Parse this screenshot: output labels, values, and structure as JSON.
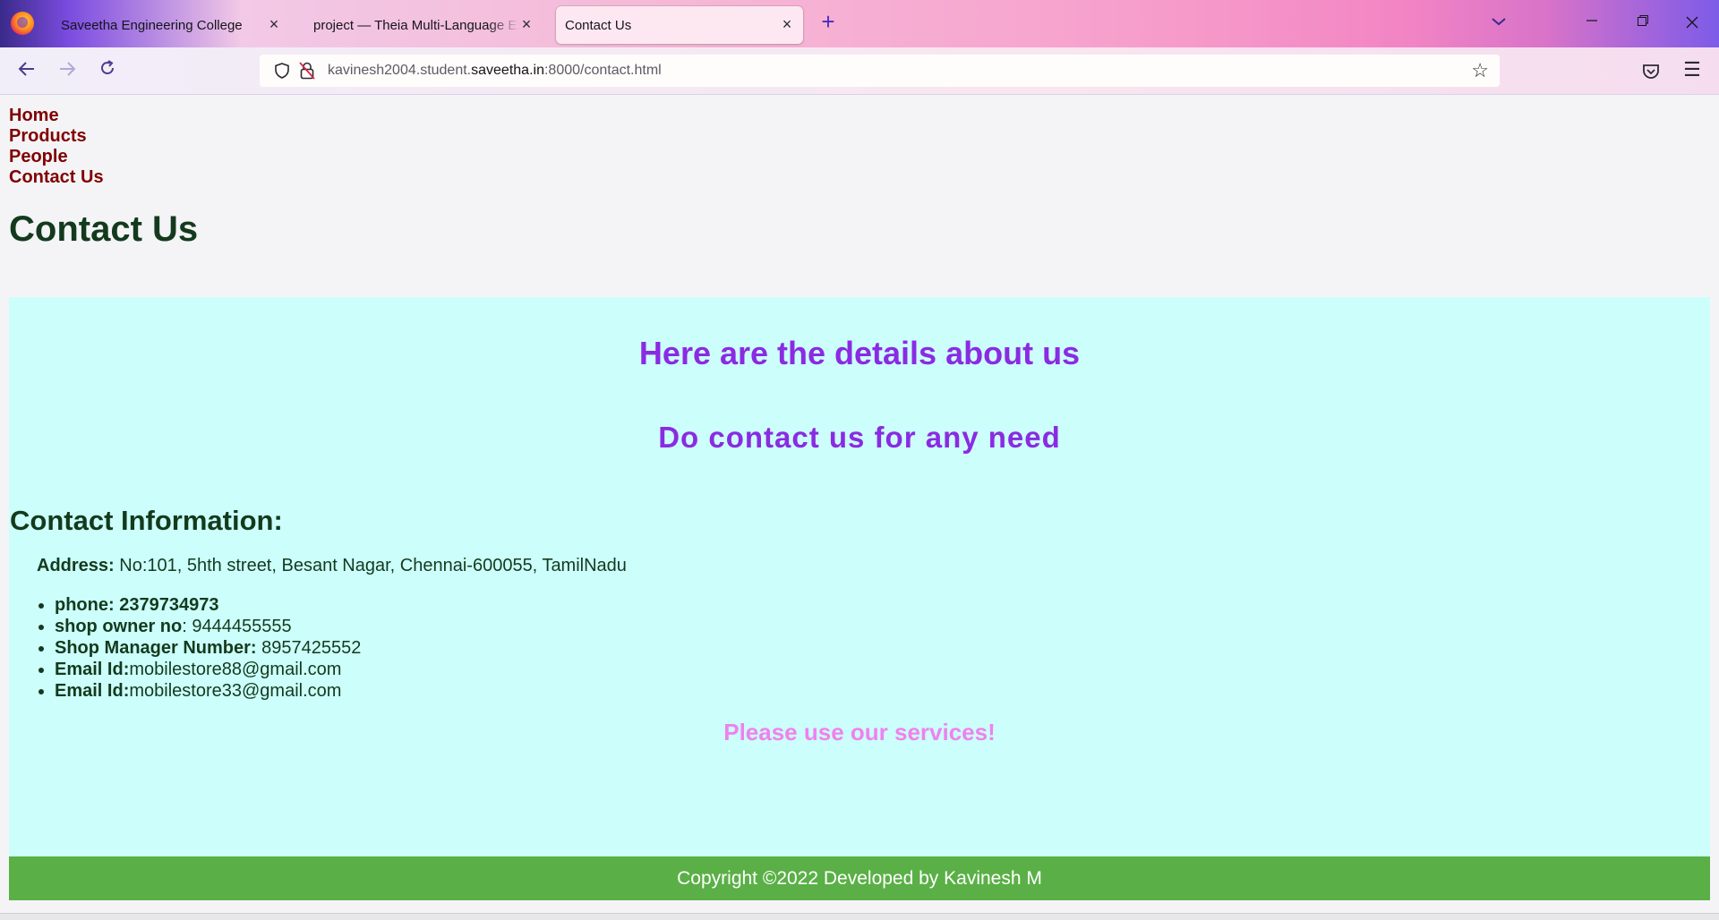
{
  "browser": {
    "tabs": [
      {
        "title": "Saveetha Engineering College",
        "close": "×"
      },
      {
        "title": "project — Theia Multi-Language Explorer",
        "close": "×"
      },
      {
        "title": "Contact Us",
        "close": "×",
        "active": true
      }
    ],
    "new_tab": "+",
    "url": {
      "prefix": "kavinesh2004.student.",
      "host": "saveetha.in",
      "suffix": ":8000/contact.html"
    },
    "icons": {
      "back": "arrow-left-icon",
      "forward": "arrow-right-icon",
      "reload": "reload-icon",
      "bookmark": "star-icon",
      "pocket": "pocket-icon",
      "menu": "hamburger-menu-icon"
    },
    "colors": {
      "accent": "#4a2dbd",
      "active_tab": "#fde8f2"
    }
  },
  "site": {
    "nav": [
      "Home",
      "Products",
      "People",
      "Contact Us"
    ],
    "page_title": "Contact Us",
    "heading_details": "Here are the details about us",
    "heading_contact": "Do contact us for any need",
    "info_heading": "Contact Information:",
    "address_label": "Address:",
    "address_value": " No:101, 5hth street, Besant Nagar, Chennai-600055, TamilNadu",
    "contacts": [
      {
        "label": "phone: 2379734973",
        "value": ""
      },
      {
        "label": "shop owner no",
        "value": ": 9444455555"
      },
      {
        "label": "Shop Manager Number:",
        "value": " 8957425552"
      },
      {
        "label": "Email Id:",
        "value": "mobilestore88@gmail.com"
      },
      {
        "label": "Email Id:",
        "value": "mobilestore33@gmail.com"
      }
    ],
    "services": "Please use our services!",
    "footer": "Copyright ©2022 Developed by Kavinesh M",
    "colors": {
      "nav_link": "#800000",
      "heading": "#8a2be2",
      "content_bg": "#ccfffc",
      "services": "#ee82ee",
      "footer_bg": "#5ab046"
    }
  }
}
